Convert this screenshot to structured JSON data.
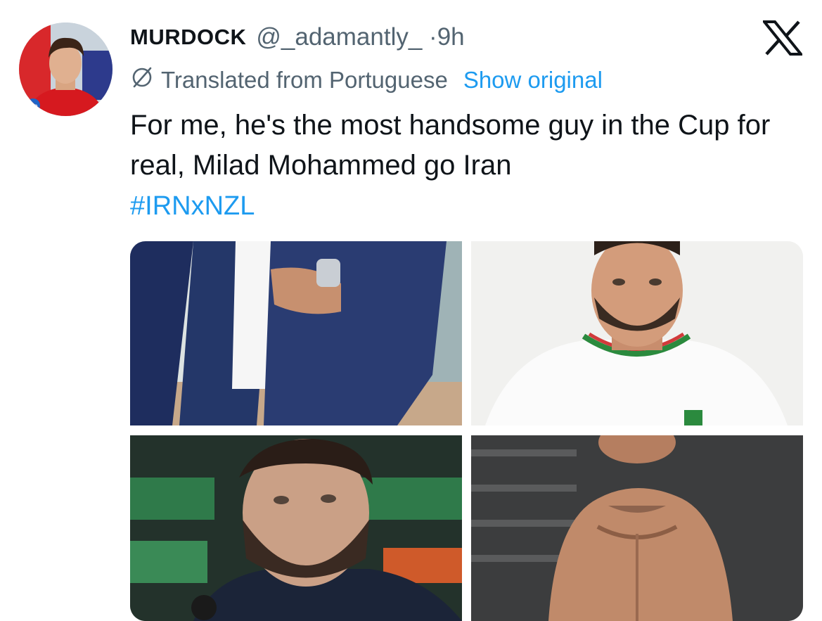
{
  "tweet": {
    "display_name": "MURDOCK",
    "handle_time": "@_adamantly_ ·9h",
    "translation_note": "Translated from Portuguese",
    "show_original": "Show original",
    "body": "For me, he's the most handsome guy in the Cup for real, Milad Mohammed go Iran",
    "hashtag": "#IRNxNZL"
  },
  "icons": {
    "platform": "x-logo-icon",
    "translate": "globe-slash-icon"
  },
  "media": {
    "count": 4,
    "descriptions": [
      "man in navy suit adjusting jacket, wristwatch visible",
      "bearded man in white Iran national team jersey",
      "bearded man with dark hair at press conference",
      "shirtless man in gym"
    ]
  },
  "colors": {
    "link": "#1d9bf0",
    "secondary_text": "#536471",
    "primary_text": "#0f1419"
  }
}
